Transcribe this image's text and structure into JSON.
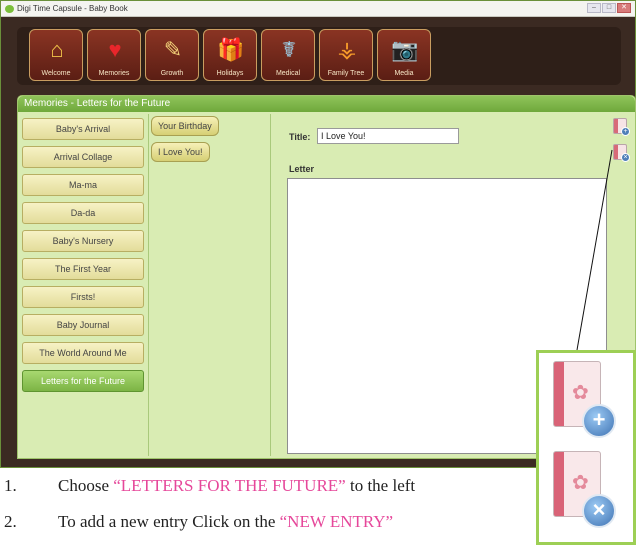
{
  "window": {
    "title": "Digi Time Capsule - Baby Book",
    "controls": [
      "–",
      "□",
      "✕"
    ]
  },
  "toolbar": {
    "items": [
      {
        "label": "Welcome",
        "icon": "house-icon",
        "glyph": "⌂"
      },
      {
        "label": "Memories",
        "icon": "heart-icon",
        "glyph": "♥"
      },
      {
        "label": "Growth",
        "icon": "ruler-pencil-icon",
        "glyph": "✎"
      },
      {
        "label": "Holidays",
        "icon": "gift-icon",
        "glyph": "🎁"
      },
      {
        "label": "Medical",
        "icon": "caduceus-icon",
        "glyph": "☤"
      },
      {
        "label": "Family Tree",
        "icon": "family-tree-icon",
        "glyph": "⚶"
      },
      {
        "label": "Media",
        "icon": "camera-icon",
        "glyph": "📷"
      }
    ]
  },
  "panel": {
    "header": "Memories - Letters for the Future",
    "categories": [
      "Baby's Arrival",
      "Arrival Collage",
      "Ma-ma",
      "Da-da",
      "Baby's Nursery",
      "The First Year",
      "Firsts!",
      "Baby Journal",
      "The World Around Me",
      "Letters for the Future"
    ],
    "active_category": "Letters for the Future",
    "entries": [
      "Your Birthday",
      "I Love You!"
    ],
    "editor": {
      "title_label": "Title:",
      "title_value": "I Love You!",
      "letter_label": "Letter"
    }
  },
  "instructions": [
    {
      "num": "1.",
      "before": "Choose ",
      "highlight": "“LETTERS FOR THE FUTURE”",
      "after": " to the left"
    },
    {
      "num": "2.",
      "before": "To add a new entry Click on the ",
      "highlight": "“NEW ENTRY”",
      "after": ""
    }
  ],
  "colors": {
    "accent_green": "#8fc45a",
    "highlight_pink": "#e6479a",
    "window_brown": "#3b2a22"
  }
}
